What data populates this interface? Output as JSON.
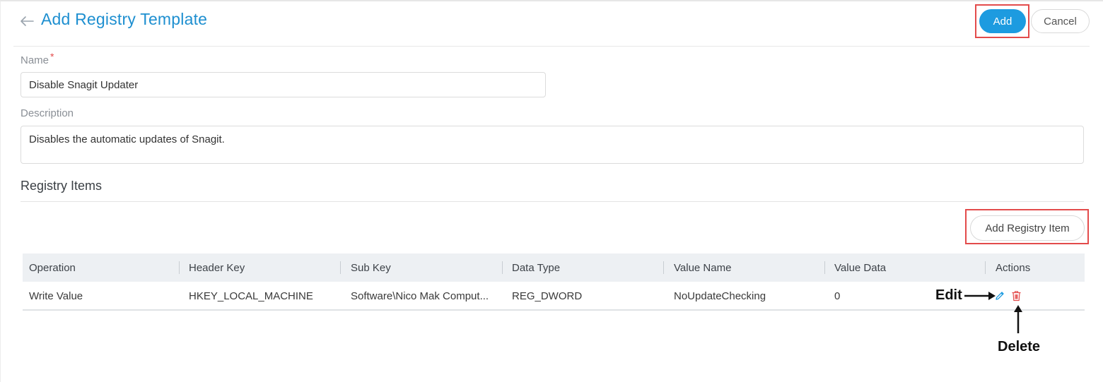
{
  "header": {
    "title": "Add Registry Template",
    "add_label": "Add",
    "cancel_label": "Cancel"
  },
  "form": {
    "name_label": "Name",
    "name_required": "*",
    "name_value": "Disable Snagit Updater",
    "description_label": "Description",
    "description_value": "Disables the automatic updates of Snagit."
  },
  "registry": {
    "section_title": "Registry Items",
    "add_item_label": "Add Registry Item",
    "columns": [
      "Operation",
      "Header Key",
      "Sub Key",
      "Data Type",
      "Value Name",
      "Value Data",
      "Actions"
    ],
    "rows": [
      {
        "operation": "Write Value",
        "header_key": "HKEY_LOCAL_MACHINE",
        "sub_key": "Software\\Nico Mak Comput...",
        "data_type": "REG_DWORD",
        "value_name": "NoUpdateChecking",
        "value_data": "0"
      }
    ]
  },
  "annotations": {
    "edit": "Edit",
    "delete": "Delete"
  },
  "colors": {
    "accent": "#1d9be0",
    "highlight": "#e34b4b",
    "delete_icon": "#e34b4b",
    "edit_icon": "#1d9be0"
  },
  "icons": [
    "back-arrow-icon",
    "edit-icon",
    "delete-icon"
  ]
}
